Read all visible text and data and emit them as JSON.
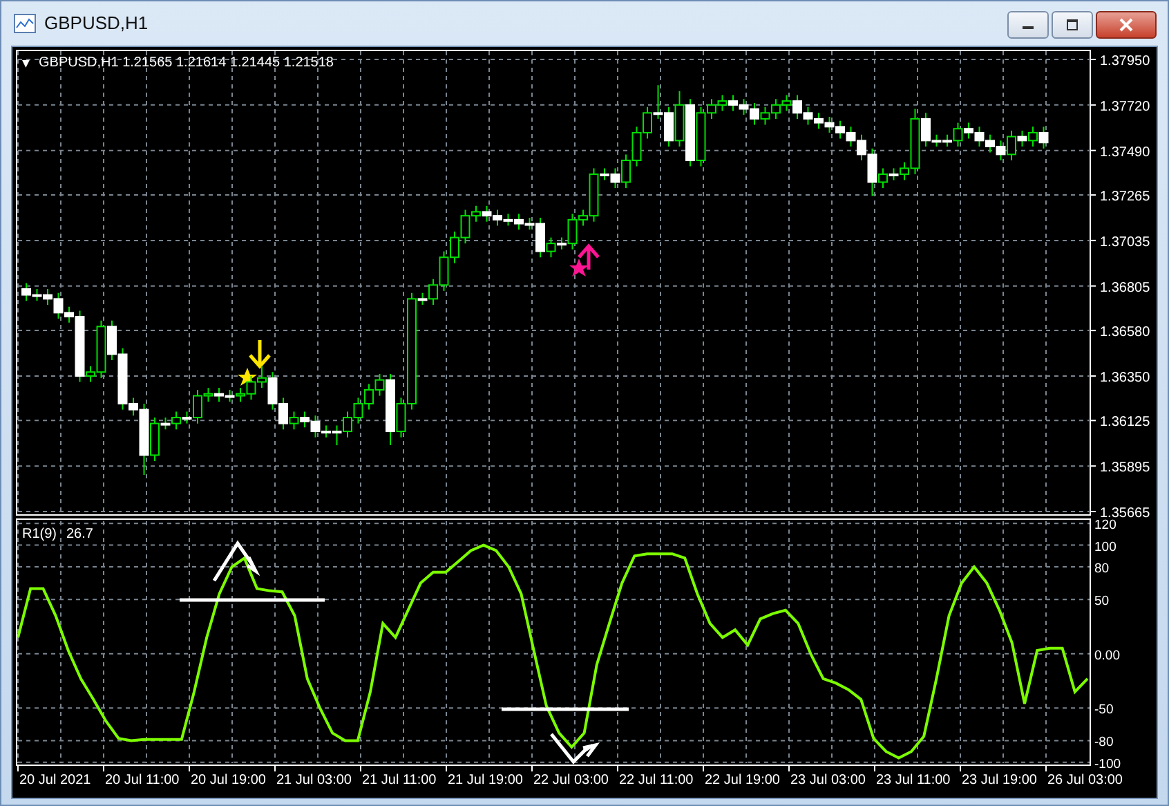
{
  "window": {
    "title": "GBPUSD,H1"
  },
  "price_panel": {
    "menu_glyph": "▼",
    "header": "GBPUSD,H1  1.21565 1.21614 1.21445 1.21518",
    "chart_data": {
      "type": "candlestick",
      "ylim": [
        1.35651,
        1.37992
      ],
      "yticks": [
        {
          "value": 1.3795,
          "label": "1.37950"
        },
        {
          "value": 1.3772,
          "label": "1.37720"
        },
        {
          "value": 1.3749,
          "label": "1.37490"
        },
        {
          "value": 1.37265,
          "label": "1.37265"
        },
        {
          "value": 1.37035,
          "label": "1.37035"
        },
        {
          "value": 1.36805,
          "label": "1.36805"
        },
        {
          "value": 1.3658,
          "label": "1.36580"
        },
        {
          "value": 1.3635,
          "label": "1.36350"
        },
        {
          "value": 1.36125,
          "label": "1.36125"
        },
        {
          "value": 1.35895,
          "label": "1.35895"
        },
        {
          "value": 1.35665,
          "label": "1.35665"
        }
      ],
      "ohlc": [
        [
          1.3679,
          1.3682,
          1.3673,
          1.3676
        ],
        [
          1.3676,
          1.3679,
          1.3673,
          1.3676
        ],
        [
          1.3676,
          1.3679,
          1.3671,
          1.3674
        ],
        [
          1.3674,
          1.3677,
          1.3664,
          1.3667
        ],
        [
          1.3667,
          1.367,
          1.3662,
          1.3665
        ],
        [
          1.3665,
          1.3668,
          1.3632,
          1.3635
        ],
        [
          1.3635,
          1.364,
          1.3632,
          1.3637
        ],
        [
          1.3637,
          1.3663,
          1.3634,
          1.366
        ],
        [
          1.366,
          1.3663,
          1.3643,
          1.3646
        ],
        [
          1.3646,
          1.3649,
          1.3618,
          1.3621
        ],
        [
          1.3621,
          1.3624,
          1.3615,
          1.3618
        ],
        [
          1.3618,
          1.3621,
          1.3585,
          1.3595
        ],
        [
          1.3595,
          1.3614,
          1.3592,
          1.3611
        ],
        [
          1.3611,
          1.3614,
          1.3608,
          1.3611
        ],
        [
          1.3611,
          1.3617,
          1.3608,
          1.3614
        ],
        [
          1.3614,
          1.3617,
          1.3611,
          1.3614
        ],
        [
          1.3614,
          1.3628,
          1.3611,
          1.3625
        ],
        [
          1.3625,
          1.3629,
          1.3622,
          1.3626
        ],
        [
          1.3626,
          1.3629,
          1.3622,
          1.3625
        ],
        [
          1.3625,
          1.3628,
          1.3622,
          1.3625
        ],
        [
          1.3625,
          1.3629,
          1.3622,
          1.3626
        ],
        [
          1.3626,
          1.3635,
          1.3623,
          1.3632
        ],
        [
          1.3632,
          1.364,
          1.3629,
          1.3634
        ],
        [
          1.3634,
          1.3637,
          1.3618,
          1.3621
        ],
        [
          1.3621,
          1.3624,
          1.3608,
          1.3611
        ],
        [
          1.3611,
          1.3617,
          1.3608,
          1.3614
        ],
        [
          1.3614,
          1.3617,
          1.3609,
          1.3612
        ],
        [
          1.3612,
          1.3615,
          1.3604,
          1.3607
        ],
        [
          1.3607,
          1.361,
          1.3604,
          1.3607
        ],
        [
          1.3607,
          1.361,
          1.36,
          1.3607
        ],
        [
          1.3607,
          1.3617,
          1.3604,
          1.3614
        ],
        [
          1.3614,
          1.3624,
          1.3611,
          1.3621
        ],
        [
          1.3621,
          1.3631,
          1.3618,
          1.3628
        ],
        [
          1.3628,
          1.3636,
          1.3625,
          1.3633
        ],
        [
          1.3633,
          1.3636,
          1.36,
          1.3607
        ],
        [
          1.3607,
          1.3624,
          1.3604,
          1.3621
        ],
        [
          1.3621,
          1.3677,
          1.3618,
          1.3674
        ],
        [
          1.3674,
          1.3677,
          1.3671,
          1.3674
        ],
        [
          1.3674,
          1.3684,
          1.3671,
          1.3681
        ],
        [
          1.3681,
          1.3698,
          1.3678,
          1.3695
        ],
        [
          1.3695,
          1.3708,
          1.3692,
          1.3705
        ],
        [
          1.3705,
          1.3719,
          1.3702,
          1.3716
        ],
        [
          1.3716,
          1.3721,
          1.3713,
          1.3718
        ],
        [
          1.3718,
          1.3721,
          1.3713,
          1.3716
        ],
        [
          1.3716,
          1.3719,
          1.3711,
          1.3714
        ],
        [
          1.3714,
          1.3717,
          1.3711,
          1.3714
        ],
        [
          1.3714,
          1.3717,
          1.3709,
          1.3712
        ],
        [
          1.3712,
          1.3715,
          1.3709,
          1.3712
        ],
        [
          1.3712,
          1.3715,
          1.3695,
          1.3698
        ],
        [
          1.3698,
          1.3705,
          1.3695,
          1.3702
        ],
        [
          1.3702,
          1.3705,
          1.3699,
          1.3702
        ],
        [
          1.3702,
          1.3717,
          1.3699,
          1.3714
        ],
        [
          1.3714,
          1.3719,
          1.3711,
          1.3716
        ],
        [
          1.3716,
          1.374,
          1.3713,
          1.3737
        ],
        [
          1.3737,
          1.374,
          1.3734,
          1.3737
        ],
        [
          1.3737,
          1.374,
          1.373,
          1.3733
        ],
        [
          1.3733,
          1.3747,
          1.373,
          1.3744
        ],
        [
          1.3744,
          1.3761,
          1.3741,
          1.3758
        ],
        [
          1.3758,
          1.3771,
          1.3755,
          1.3768
        ],
        [
          1.3768,
          1.3782,
          1.3765,
          1.3768
        ],
        [
          1.3768,
          1.3771,
          1.3751,
          1.3754
        ],
        [
          1.3754,
          1.3779,
          1.3751,
          1.3772
        ],
        [
          1.3772,
          1.3775,
          1.3741,
          1.3744
        ],
        [
          1.3744,
          1.3771,
          1.3741,
          1.3768
        ],
        [
          1.3768,
          1.3775,
          1.3765,
          1.3772
        ],
        [
          1.3772,
          1.3777,
          1.3769,
          1.3774
        ],
        [
          1.3774,
          1.3777,
          1.3769,
          1.3772
        ],
        [
          1.3772,
          1.3775,
          1.3767,
          1.377
        ],
        [
          1.377,
          1.3773,
          1.3762,
          1.3765
        ],
        [
          1.3765,
          1.3771,
          1.3762,
          1.3768
        ],
        [
          1.3768,
          1.3775,
          1.3765,
          1.3772
        ],
        [
          1.3772,
          1.3777,
          1.3769,
          1.3774
        ],
        [
          1.3774,
          1.3777,
          1.3765,
          1.3768
        ],
        [
          1.3768,
          1.3771,
          1.3762,
          1.3765
        ],
        [
          1.3765,
          1.3768,
          1.376,
          1.3763
        ],
        [
          1.3763,
          1.3766,
          1.3758,
          1.3761
        ],
        [
          1.3761,
          1.3764,
          1.3755,
          1.3758
        ],
        [
          1.3758,
          1.3761,
          1.3751,
          1.3754
        ],
        [
          1.3754,
          1.3757,
          1.3744,
          1.3747
        ],
        [
          1.3747,
          1.375,
          1.3726,
          1.3733
        ],
        [
          1.3733,
          1.374,
          1.373,
          1.3737
        ],
        [
          1.3737,
          1.374,
          1.3734,
          1.3737
        ],
        [
          1.3737,
          1.3743,
          1.3734,
          1.374
        ],
        [
          1.374,
          1.377,
          1.3737,
          1.3765
        ],
        [
          1.3765,
          1.3768,
          1.3751,
          1.3754
        ],
        [
          1.3754,
          1.3757,
          1.3751,
          1.3754
        ],
        [
          1.3754,
          1.3757,
          1.3751,
          1.3754
        ],
        [
          1.3754,
          1.3763,
          1.3751,
          1.376
        ],
        [
          1.376,
          1.3763,
          1.3755,
          1.3758
        ],
        [
          1.3758,
          1.3761,
          1.3751,
          1.3754
        ],
        [
          1.3754,
          1.3757,
          1.3748,
          1.3751
        ],
        [
          1.3751,
          1.3754,
          1.3744,
          1.3747
        ],
        [
          1.3747,
          1.3759,
          1.3744,
          1.3756
        ],
        [
          1.3756,
          1.3759,
          1.3751,
          1.3754
        ],
        [
          1.3754,
          1.3761,
          1.3751,
          1.3758
        ],
        [
          1.3758,
          1.3761,
          1.375,
          1.3753
        ]
      ]
    }
  },
  "indicator_panel": {
    "reading": "26.7",
    "chart_data": {
      "type": "line",
      "ylim": [
        -102,
        122
      ],
      "yticks": [
        {
          "value": 120,
          "label": "120"
        },
        {
          "value": 100,
          "label": "100"
        },
        {
          "value": 80,
          "label": "80"
        },
        {
          "value": 50,
          "label": "50"
        },
        {
          "value": 0,
          "label": "0.00"
        },
        {
          "value": -50,
          "label": "-50"
        },
        {
          "value": -80,
          "label": "-80"
        },
        {
          "value": -100,
          "label": "-100"
        }
      ],
      "series": [
        {
          "name": "R1(9)",
          "color": "#7cfc00",
          "values": [
            15,
            60,
            60,
            35,
            3,
            -23,
            -42,
            -62,
            -78,
            -80,
            -79,
            -79,
            -79,
            -79,
            -35,
            15,
            55,
            80,
            88,
            60,
            58,
            57,
            35,
            -23,
            -50,
            -73,
            -80,
            -80,
            -35,
            28,
            15,
            40,
            65,
            75,
            75,
            85,
            95,
            100,
            95,
            80,
            55,
            3,
            -48,
            -73,
            -86,
            -73,
            -10,
            28,
            65,
            90,
            92,
            92,
            92,
            88,
            55,
            28,
            15,
            22,
            8,
            32,
            37,
            40,
            28,
            0,
            -23,
            -27,
            -33,
            -42,
            -78,
            -90,
            -96,
            -90,
            -76,
            -23,
            35,
            65,
            80,
            65,
            40,
            10,
            -46,
            3,
            5,
            5,
            -35,
            -23
          ]
        }
      ]
    }
  },
  "time_axis": [
    "20 Jul 2021",
    "20 Jul 11:00",
    "20 Jul 19:00",
    "21 Jul 03:00",
    "21 Jul 11:00",
    "21 Jul 19:00",
    "22 Jul 03:00",
    "22 Jul 11:00",
    "22 Jul 19:00",
    "23 Jul 03:00",
    "23 Jul 11:00",
    "23 Jul 19:00",
    "26 Jul 03:00"
  ]
}
